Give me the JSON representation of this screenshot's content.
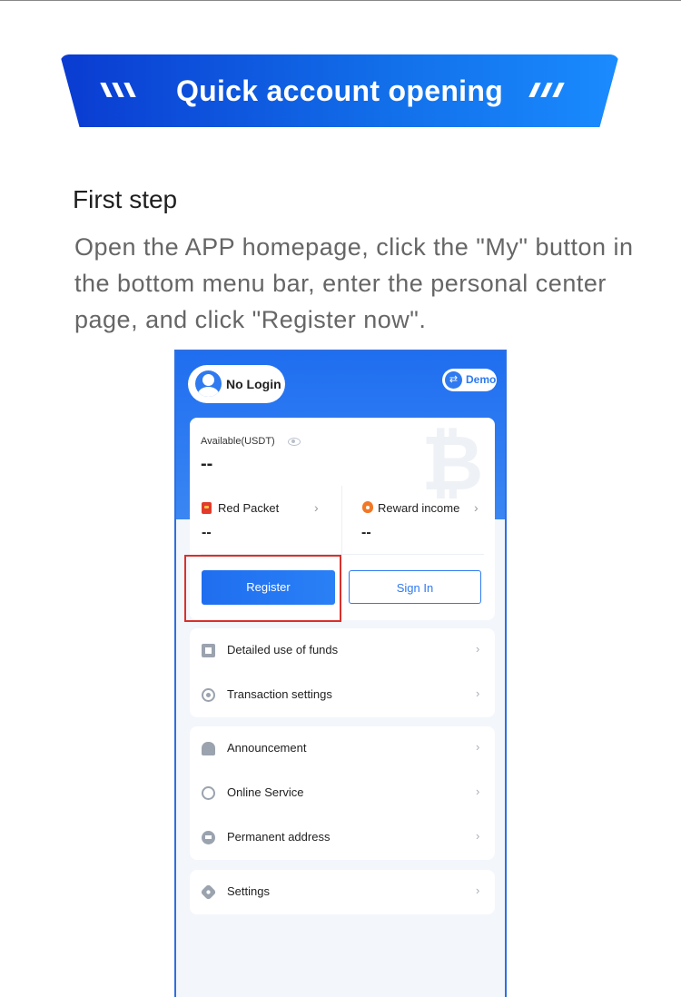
{
  "banner": {
    "title": "Quick account opening"
  },
  "step": {
    "title": "First step",
    "description": "Open the APP homepage, click the \"My\" button in the bottom menu bar, enter the personal center page, and click \"Register now\"."
  },
  "phone": {
    "login_label": "No Login",
    "demo_label": "Demo",
    "available_label": "Available(USDT)",
    "available_value": "--",
    "red_packet": {
      "label": "Red Packet",
      "value": "--"
    },
    "reward_income": {
      "label": "Reward income",
      "value": "--"
    },
    "register_label": "Register",
    "signin_label": "Sign In",
    "menu_group_1": [
      {
        "label": "Detailed use of funds",
        "icon": "fund-icon"
      },
      {
        "label": "Transaction settings",
        "icon": "transaction-settings-icon"
      }
    ],
    "menu_group_2": [
      {
        "label": "Announcement",
        "icon": "bell-icon"
      },
      {
        "label": "Online Service",
        "icon": "headset-icon"
      },
      {
        "label": "Permanent address",
        "icon": "link-icon"
      }
    ],
    "menu_group_3": [
      {
        "label": "Settings",
        "icon": "settings-icon"
      }
    ],
    "chevron": "›",
    "colors": {
      "accent": "#1f6ef0",
      "highlight": "#d9302b",
      "banner_start": "#0a3bd1",
      "banner_end": "#1a8bff"
    }
  }
}
